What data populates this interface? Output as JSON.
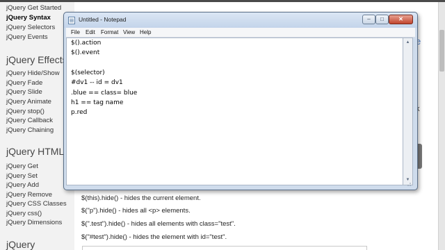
{
  "page": {
    "sidebar_top_links": [
      "jQuery Get Started",
      "jQuery Syntax",
      "jQuery Selectors",
      "jQuery Events"
    ],
    "active_link_index": 1,
    "effects_heading": "jQuery Effects",
    "effects_links": [
      "jQuery Hide/Show",
      "jQuery Fade",
      "jQuery Slide",
      "jQuery Animate",
      "jQuery stop()",
      "jQuery Callback",
      "jQuery Chaining"
    ],
    "html_heading": "jQuery HTML",
    "html_links": [
      "jQuery Get",
      "jQuery Set",
      "jQuery Add",
      "jQuery Remove",
      "jQuery CSS Classes",
      "jQuery css()",
      "jQuery Dimensions"
    ],
    "bottom_heading": "jQuery",
    "content_lines": [
      "$(this).hide() - hides the current element.",
      "$(\"p\").hide() - hides all <p> elements.",
      "$(\".test\").hide() - hides all elements with class=\"test\".",
      "$(\"#test\").hide() - hides the element with id=\"test\"."
    ],
    "right_fragments": [
      "e",
      "k"
    ]
  },
  "notepad": {
    "title": "Untitled - Notepad",
    "menu": [
      "File",
      "Edit",
      "Format",
      "View",
      "Help"
    ],
    "lines": [
      "$().action",
      "$().event",
      "",
      "$(selector)",
      "#dv1 -- id = dv1",
      ".blue == class= blue",
      "h1 == tag name",
      "p.red"
    ],
    "buttons": {
      "minimize": "–",
      "maximize": "□",
      "close": "✕"
    }
  }
}
